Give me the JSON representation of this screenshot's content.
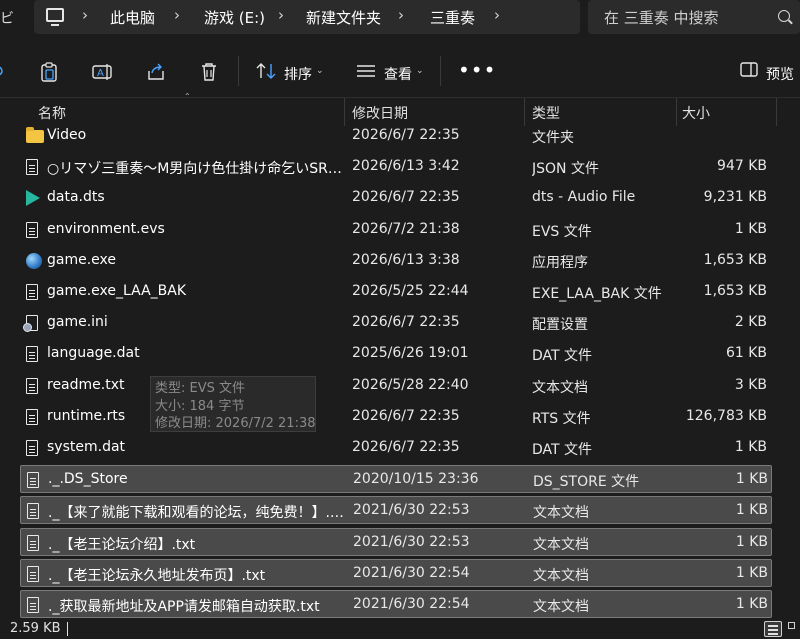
{
  "address_bar": {
    "edge_glyph": "ビ",
    "breadcrumbs": [
      "此电脑",
      "游戏 (E:)",
      "新建文件夹",
      "三重奏"
    ],
    "search_placeholder": "在 三重奏 中搜索"
  },
  "toolbar": {
    "sort_label": "排序",
    "view_label": "查看",
    "preview_label": "预览"
  },
  "columns": {
    "name": "名称",
    "date": "修改日期",
    "type": "类型",
    "size": "大小"
  },
  "files": [
    {
      "icon": "folder-icon",
      "name": "Video",
      "date": "2026/6/7 22:35",
      "type": "文件夹",
      "size": "",
      "selected": false
    },
    {
      "icon": "document-icon",
      "name": "○リマゾ三重奏～M男向け色仕掛け命乞いSRP...",
      "date": "2026/6/13 3:42",
      "type": "JSON 文件",
      "size": "947 KB",
      "selected": false
    },
    {
      "icon": "media-icon",
      "name": "data.dts",
      "date": "2026/6/7 22:35",
      "type": "dts - Audio File",
      "size": "9,231 KB",
      "selected": false
    },
    {
      "icon": "document-icon",
      "name": "environment.evs",
      "date": "2026/7/2 21:38",
      "type": "EVS 文件",
      "size": "1 KB",
      "selected": false
    },
    {
      "icon": "globe-icon",
      "name": "game.exe",
      "date": "2026/6/13 3:38",
      "type": "应用程序",
      "size": "1,653 KB",
      "selected": false
    },
    {
      "icon": "document-icon",
      "name": "game.exe_LAA_BAK",
      "date": "2026/5/25 22:44",
      "type": "EXE_LAA_BAK 文件",
      "size": "1,653 KB",
      "selected": false
    },
    {
      "icon": "settings-file-icon",
      "name": "game.ini",
      "date": "2026/6/7 22:35",
      "type": "配置设置",
      "size": "2 KB",
      "selected": false
    },
    {
      "icon": "document-icon",
      "name": "language.dat",
      "date": "2025/6/26 19:01",
      "type": "DAT 文件",
      "size": "61 KB",
      "selected": false
    },
    {
      "icon": "document-icon",
      "name": "readme.txt",
      "date": "2026/5/28 22:40",
      "type": "文本文档",
      "size": "3 KB",
      "selected": false
    },
    {
      "icon": "document-icon",
      "name": "runtime.rts",
      "date": "2026/6/7 22:35",
      "type": "RTS 文件",
      "size": "126,783 KB",
      "selected": false
    },
    {
      "icon": "document-icon",
      "name": "system.dat",
      "date": "2026/6/7 22:35",
      "type": "DAT 文件",
      "size": "1 KB",
      "selected": false
    },
    {
      "icon": "document-icon",
      "name": "._.DS_Store",
      "date": "2020/10/15 23:36",
      "type": "DS_STORE 文件",
      "size": "1 KB",
      "selected": true
    },
    {
      "icon": "document-icon",
      "name": "._【来了就能下载和观看的论坛，纯免费！】.txt",
      "date": "2021/6/30 22:53",
      "type": "文本文档",
      "size": "1 KB",
      "selected": true
    },
    {
      "icon": "document-icon",
      "name": "._【老王论坛介绍】.txt",
      "date": "2021/6/30 22:53",
      "type": "文本文档",
      "size": "1 KB",
      "selected": true
    },
    {
      "icon": "document-icon",
      "name": "._【老王论坛永久地址发布页】.txt",
      "date": "2021/6/30 22:54",
      "type": "文本文档",
      "size": "1 KB",
      "selected": true
    },
    {
      "icon": "document-icon",
      "name": "._获取最新地址及APP请发邮箱自动获取.txt",
      "date": "2021/6/30 22:54",
      "type": "文本文档",
      "size": "1 KB",
      "selected": true
    }
  ],
  "tooltip": {
    "type_line": "类型: EVS 文件",
    "size_line": "大小: 184 字节",
    "date_line": "修改日期: 2026/7/2 21:38"
  },
  "status": {
    "selection_size": "2.59 KB"
  }
}
